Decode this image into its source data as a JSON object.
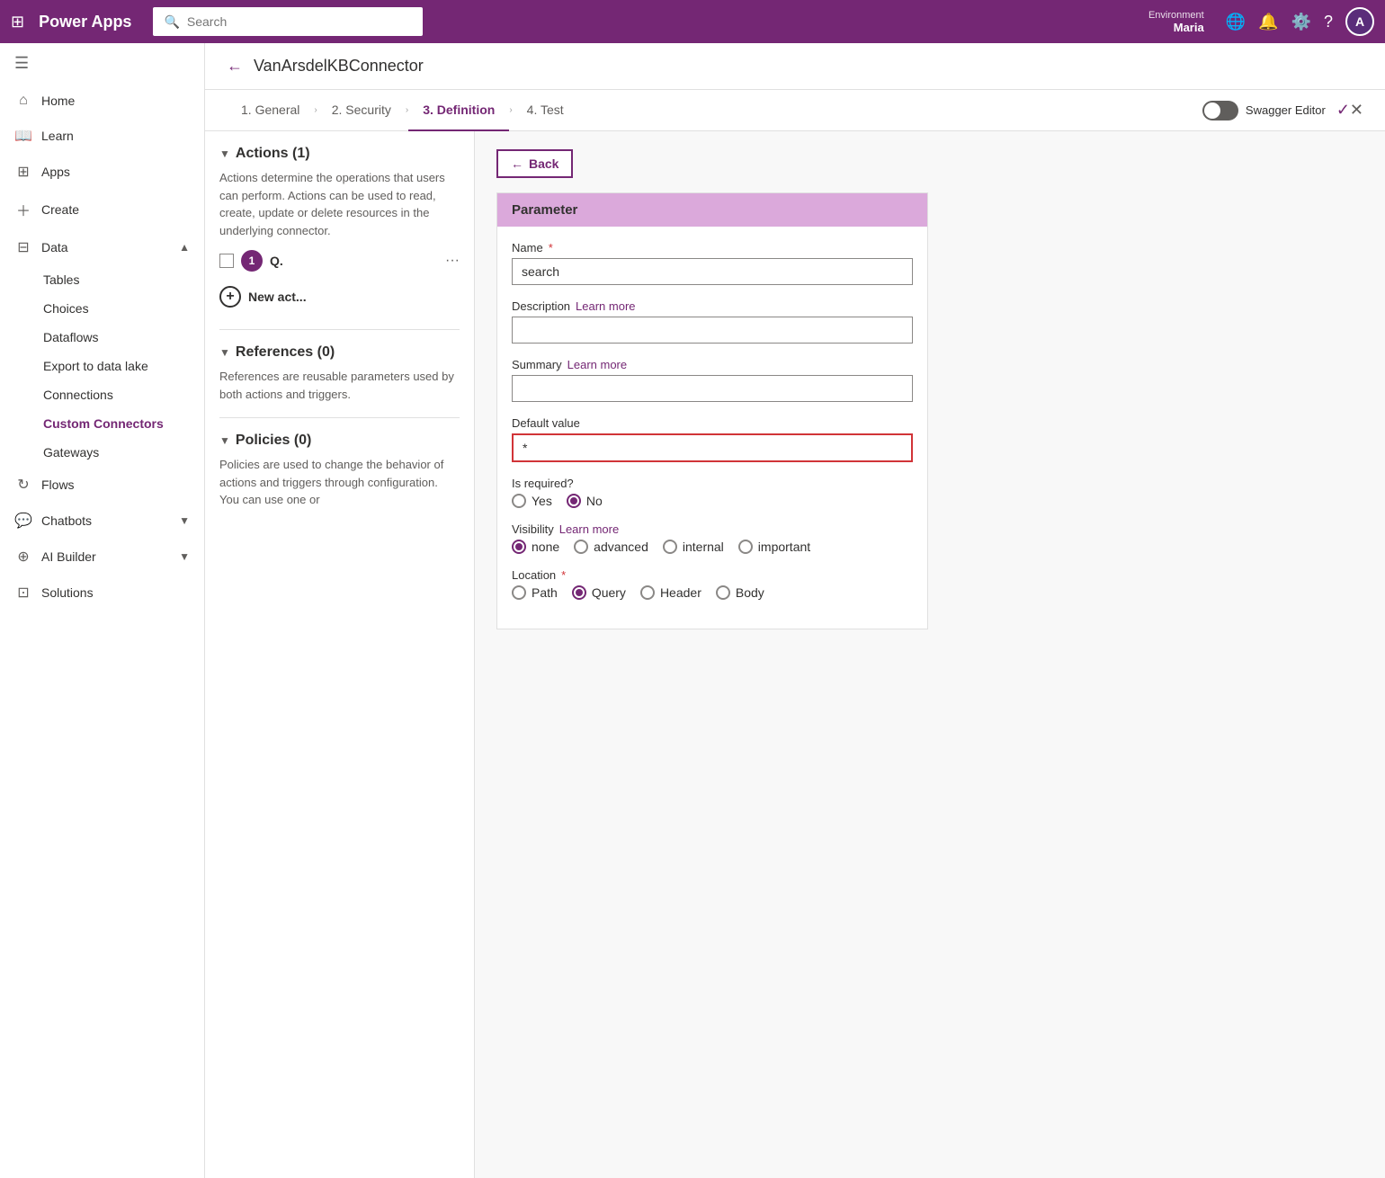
{
  "topnav": {
    "brand": "Power Apps",
    "search_placeholder": "Search",
    "env_label": "Environment",
    "env_name": "Maria",
    "avatar_initials": "A"
  },
  "sidebar": {
    "toggle_icon": "☰",
    "items": [
      {
        "id": "home",
        "icon": "⌂",
        "label": "Home",
        "active": false
      },
      {
        "id": "learn",
        "icon": "📖",
        "label": "Learn",
        "active": false
      },
      {
        "id": "apps",
        "icon": "⊞",
        "label": "Apps",
        "active": false
      },
      {
        "id": "create",
        "icon": "+",
        "label": "Create",
        "active": false
      },
      {
        "id": "data",
        "icon": "⊟",
        "label": "Data",
        "active": false,
        "expandable": true,
        "expanded": true
      },
      {
        "id": "tables",
        "icon": "",
        "label": "Tables",
        "sub": true
      },
      {
        "id": "choices",
        "icon": "",
        "label": "Choices",
        "sub": true
      },
      {
        "id": "dataflows",
        "icon": "",
        "label": "Dataflows",
        "sub": true
      },
      {
        "id": "export",
        "icon": "",
        "label": "Export to data lake",
        "sub": true
      },
      {
        "id": "connections",
        "icon": "",
        "label": "Connections",
        "sub": true
      },
      {
        "id": "custom-connectors",
        "icon": "",
        "label": "Custom Connectors",
        "sub": true,
        "active": true
      },
      {
        "id": "gateways",
        "icon": "",
        "label": "Gateways",
        "sub": true
      },
      {
        "id": "flows",
        "icon": "↻",
        "label": "Flows",
        "active": false
      },
      {
        "id": "chatbots",
        "icon": "💬",
        "label": "Chatbots",
        "active": false,
        "expandable": true
      },
      {
        "id": "ai-builder",
        "icon": "⊕",
        "label": "AI Builder",
        "active": false,
        "expandable": true
      },
      {
        "id": "solutions",
        "icon": "⊡",
        "label": "Solutions",
        "active": false
      }
    ]
  },
  "header": {
    "back_arrow": "←",
    "connector_title": "VanArsdelKBConnector"
  },
  "tabs": [
    {
      "id": "general",
      "label": "1. General",
      "active": false
    },
    {
      "id": "security",
      "label": "2. Security",
      "active": false
    },
    {
      "id": "definition",
      "label": "3. Definition",
      "active": true
    },
    {
      "id": "test",
      "label": "4. Test",
      "active": false
    }
  ],
  "swagger": {
    "label": "Swagger Editor"
  },
  "left_panel": {
    "actions_title": "Actions (1)",
    "actions_desc": "Actions determine the operations that users can perform. Actions can be used to read, create, update or delete resources in the underlying connector.",
    "action_badge": "1",
    "action_letter": "Q.",
    "new_action_label": "New act...",
    "references_title": "References (0)",
    "references_desc": "References are reusable parameters used by both actions and triggers.",
    "policies_title": "Policies (0)",
    "policies_desc": "Policies are used to change the behavior of actions and triggers through configuration. You can use one or"
  },
  "right_panel": {
    "back_label": "Back",
    "param_header": "Parameter",
    "name_label": "Name",
    "name_required": "*",
    "name_value": "search",
    "description_label": "Description",
    "description_learn": "Learn more",
    "summary_label": "Summary",
    "summary_learn": "Learn more",
    "default_value_label": "Default value",
    "default_value": "*",
    "is_required_label": "Is required?",
    "radio_yes": "Yes",
    "radio_no": "No",
    "visibility_label": "Visibility",
    "visibility_learn": "Learn more",
    "visibility_options": [
      "none",
      "advanced",
      "internal",
      "important"
    ],
    "visibility_selected": "none",
    "location_label": "Location",
    "location_required": "*",
    "location_options": [
      "Path",
      "Query",
      "Header",
      "Body"
    ],
    "location_selected": "Query"
  }
}
